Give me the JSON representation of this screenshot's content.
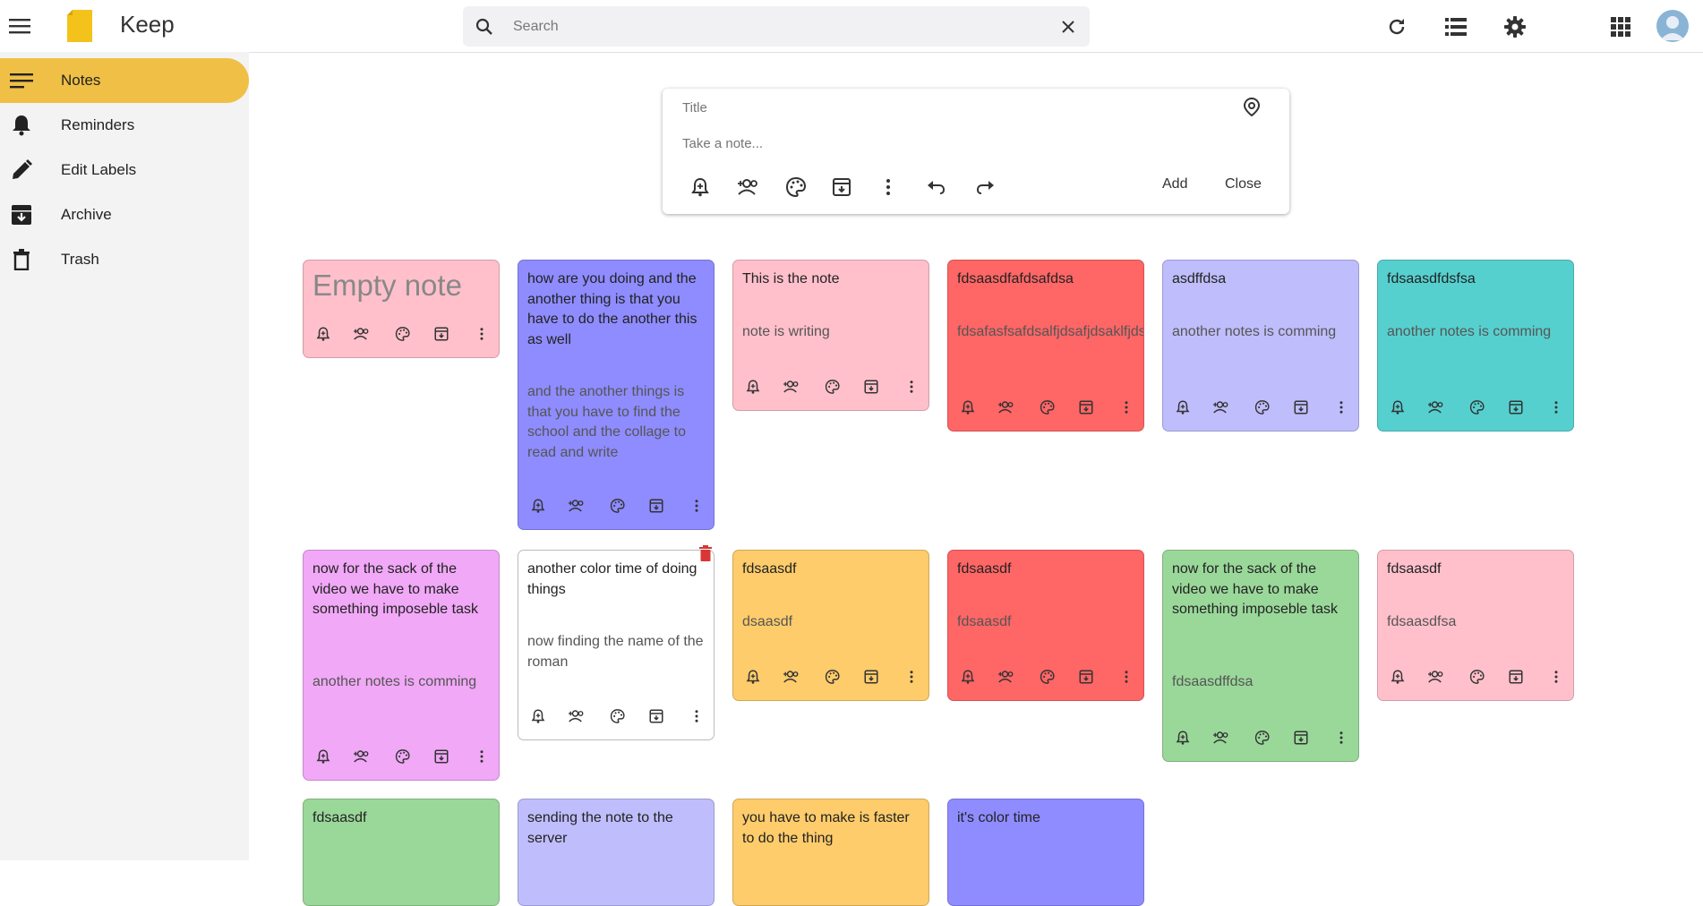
{
  "app": {
    "title": "Keep"
  },
  "search": {
    "placeholder": "Search"
  },
  "sidebar": {
    "items": [
      {
        "label": "Notes",
        "icon": "notes-icon",
        "active": true
      },
      {
        "label": "Reminders",
        "icon": "bell-icon"
      },
      {
        "label": "Edit Labels",
        "icon": "pencil-icon"
      },
      {
        "label": "Archive",
        "icon": "archive-icon"
      },
      {
        "label": "Trash",
        "icon": "trash-icon"
      }
    ]
  },
  "composer": {
    "title_placeholder": "Title",
    "body_placeholder": "Take a note...",
    "add_label": "Add",
    "close_label": "Close"
  },
  "colors": {
    "accent": "#efc045",
    "pink": "#ffc0cb",
    "blue": "#8e8cff",
    "red": "#ff6666",
    "lavender": "#bfbdfc",
    "teal": "#56d0cf",
    "magenta": "#f1a8f7",
    "white": "#ffffff",
    "orange": "#fecc6b",
    "green": "#9ad89a"
  },
  "notes": [
    {
      "title": "Empty note",
      "body": "",
      "color": "#ffc0cb"
    },
    {
      "title": "how are you doing and the another thing is that you have to do the another this as well",
      "body": "and the another things is that you have to find the school and the collage to read and write",
      "color": "#8e8cff"
    },
    {
      "title": "This is the note",
      "body": "note is writing",
      "color": "#ffc0cb"
    },
    {
      "title": "fdsaasdfafdsafdsa",
      "body": "fdsafasfsafdsalfjdsafjdsaklfjdsalkfjdsla",
      "color": "#ff6666"
    },
    {
      "title": "asdffdsa",
      "body": "another notes is comming",
      "color": "#bfbdfc"
    },
    {
      "title": "fdsaasdfdsfsa",
      "body": "another notes is comming",
      "color": "#56d0cf"
    },
    {
      "title": "now for the sack of the video we have to make something imposeble task",
      "body": "another notes is comming",
      "color": "#f1a8f7"
    },
    {
      "title": "another color time of doing things",
      "body": "now finding the name of the roman",
      "color": "#ffffff"
    },
    {
      "title": "fdsaasdf",
      "body": "dsaasdf",
      "color": "#fecc6b"
    },
    {
      "title": "fdsaasdf",
      "body": "fdsaasdf",
      "color": "#ff6666"
    },
    {
      "title": "now for the sack of the video we have to make something imposeble task",
      "body": "fdsaasdffdsa",
      "color": "#9ad89a"
    },
    {
      "title": "fdsaasdf",
      "body": "fdsaasdfsa",
      "color": "#ffc0cb"
    },
    {
      "title": "fdsaasdf",
      "body": "",
      "color": "#9ad89a"
    },
    {
      "title": "sending the note to the server",
      "body": "",
      "color": "#bfbdfc"
    },
    {
      "title": "you have to make is faster to do the thing",
      "body": "",
      "color": "#fecc6b"
    },
    {
      "title": "it's color time",
      "body": "",
      "color": "#8e8cff"
    }
  ]
}
